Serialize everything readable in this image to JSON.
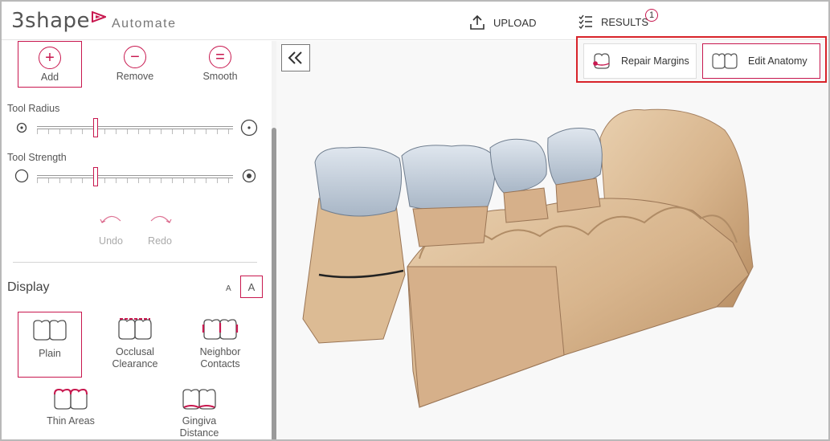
{
  "app": {
    "brand": "3shape",
    "name": "Automate"
  },
  "nav": {
    "upload": "UPLOAD",
    "results": "RESULTS",
    "results_badge": "1"
  },
  "tools": {
    "add": "Add",
    "remove": "Remove",
    "smooth": "Smooth",
    "active": "add"
  },
  "sliders": {
    "radius": {
      "label": "Tool Radius",
      "value": 0.3
    },
    "strength": {
      "label": "Tool Strength",
      "value": 0.3
    }
  },
  "history": {
    "undo": "Undo",
    "redo": "Redo"
  },
  "display": {
    "title": "Display",
    "font_small": "A",
    "font_large": "A",
    "modes": {
      "plain": "Plain",
      "occlusal_1": "Occlusal",
      "occlusal_2": "Clearance",
      "neighbor_1": "Neighbor",
      "neighbor_2": "Contacts",
      "thin": "Thin Areas",
      "gingiva_1": "Gingiva",
      "gingiva_2": "Distance"
    },
    "active": "plain"
  },
  "viewer_actions": {
    "repair": "Repair Margins",
    "edit": "Edit Anatomy"
  },
  "colors": {
    "accent": "#c8184f",
    "highlight": "#d8232a",
    "crown": "#c9d2dc",
    "model": "#dcb892"
  }
}
